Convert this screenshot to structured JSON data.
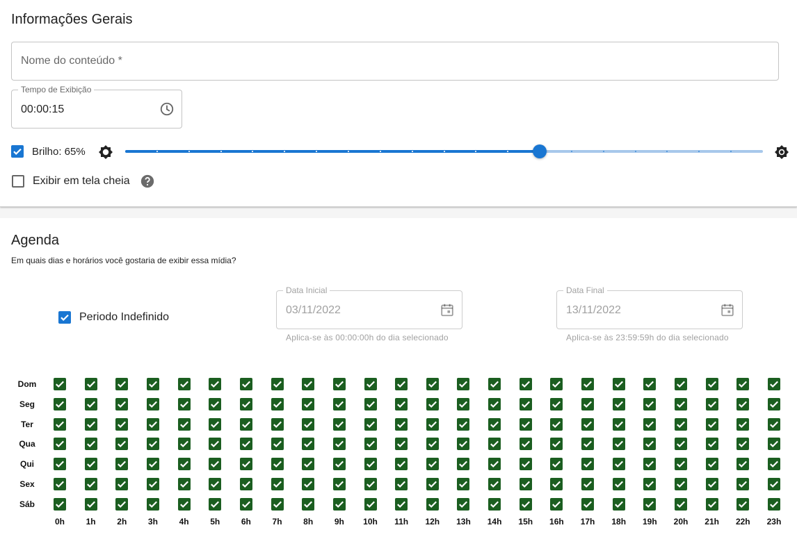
{
  "general": {
    "title": "Informações Gerais",
    "content_name_placeholder": "Nome do conteúdo *",
    "display_time": {
      "label": "Tempo de Exibição",
      "value": "00:00:15"
    },
    "brightness": {
      "label": "Brilho: 65%",
      "checked": true,
      "value_percent": 65
    },
    "fullscreen": {
      "label": "Exibir em tela cheia",
      "checked": false
    }
  },
  "schedule": {
    "title": "Agenda",
    "subtitle": "Em quais dias e horários você gostaria de exibir essa mídia?",
    "indefinite_period": {
      "label": "Periodo Indefinido",
      "checked": true
    },
    "start_date": {
      "label": "Data Inicial",
      "value": "03/11/2022",
      "helper": "Aplica-se às 00:00:00h do dia selecionado"
    },
    "end_date": {
      "label": "Data Final",
      "value": "13/11/2022",
      "helper": "Aplica-se às 23:59:59h do dia selecionado"
    },
    "days": [
      "Dom",
      "Seg",
      "Ter",
      "Qua",
      "Qui",
      "Sex",
      "Sáb"
    ],
    "hours": [
      "0h",
      "1h",
      "2h",
      "3h",
      "4h",
      "5h",
      "6h",
      "7h",
      "8h",
      "9h",
      "10h",
      "11h",
      "12h",
      "13h",
      "14h",
      "15h",
      "16h",
      "17h",
      "18h",
      "19h",
      "20h",
      "21h",
      "22h",
      "23h"
    ],
    "all_checked": true
  },
  "colors": {
    "primary": "#1976d2",
    "grid_checked": "#1b5e20"
  }
}
